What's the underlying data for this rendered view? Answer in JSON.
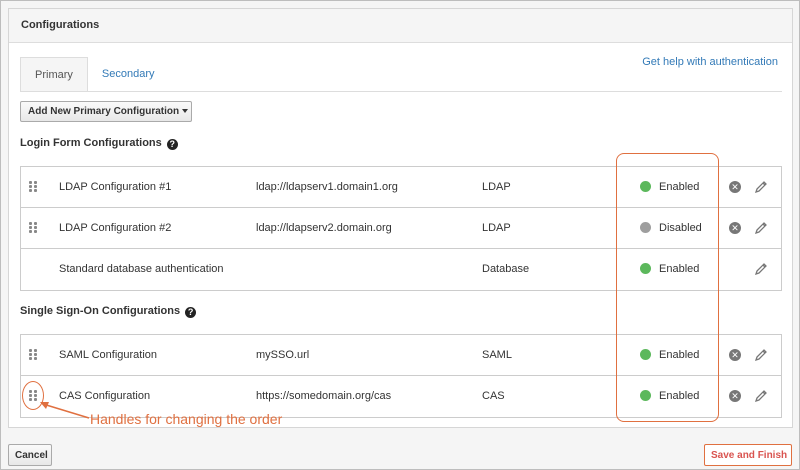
{
  "panel": {
    "title": "Configurations"
  },
  "tabs": [
    {
      "label": "Primary",
      "active": true
    },
    {
      "label": "Secondary",
      "active": false
    }
  ],
  "help_link": "Get help with authentication",
  "add_button": {
    "label": "Add New Primary Configuration"
  },
  "login_section": {
    "title": "Login Form Configurations",
    "help_icon": "?",
    "rows": [
      {
        "name": "LDAP Configuration #1",
        "url": "ldap://ldapserv1.domain1.org",
        "type": "LDAP",
        "status": "Enabled",
        "status_color": "#5cb85c",
        "draggable": true,
        "deletable": true
      },
      {
        "name": "LDAP Configuration #2",
        "url": "ldap://ldapserv2.domain.org",
        "type": "LDAP",
        "status": "Disabled",
        "status_color": "#9e9e9e",
        "draggable": true,
        "deletable": true
      },
      {
        "name": "Standard database authentication",
        "url": "",
        "type": "Database",
        "status": "Enabled",
        "status_color": "#5cb85c",
        "draggable": false,
        "deletable": false
      }
    ]
  },
  "sso_section": {
    "title": "Single Sign-On Configurations",
    "help_icon": "?",
    "rows": [
      {
        "name": "SAML Configuration",
        "url": "mySSO.url",
        "type": "SAML",
        "status": "Enabled",
        "status_color": "#5cb85c",
        "draggable": true,
        "deletable": true
      },
      {
        "name": "CAS Configuration",
        "url": "https://somedomain.org/cas",
        "type": "CAS",
        "status": "Enabled",
        "status_color": "#5cb85c",
        "draggable": true,
        "deletable": true
      }
    ]
  },
  "annotation": {
    "text": "Handles for changing the order",
    "color": "#e07040"
  },
  "footer": {
    "cancel_label": "Cancel",
    "save_label": "Save and Finish"
  },
  "icons": {
    "delete": "x-circle-icon",
    "edit": "pencil-icon",
    "handle": "drag-handle-icon",
    "help": "question-circle-icon"
  }
}
